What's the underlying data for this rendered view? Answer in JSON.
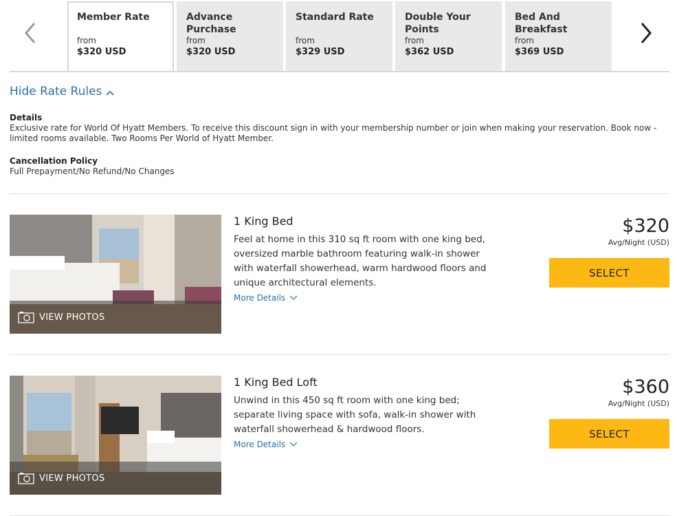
{
  "rate_tabs": {
    "prev_icon": "chevron-left-icon",
    "next_icon": "chevron-right-icon",
    "tabs": [
      {
        "name": "Member Rate",
        "from": "from",
        "price": "$320 USD",
        "active": true
      },
      {
        "name": "Advance Purchase",
        "from": "from",
        "price": "$320 USD",
        "active": false
      },
      {
        "name": "Standard Rate",
        "from": "from",
        "price": "$329 USD",
        "active": false
      },
      {
        "name": "Double Your Points",
        "from": "from",
        "price": "$362 USD",
        "active": false
      },
      {
        "name": "Bed And Breakfast",
        "from": "from",
        "price": "$369 USD",
        "active": false
      }
    ]
  },
  "rate_rules": {
    "toggle_label": "Hide Rate Rules",
    "toggle_icon": "chevron-up-icon",
    "details_heading": "Details",
    "details_text": "Exclusive rate for World Of Hyatt Members. To receive this discount sign in with your membership number or join when making your reservation. Book now - limited rooms available. Two Rooms Per World of Hyatt Member.",
    "cancel_heading": "Cancellation Policy",
    "cancel_text": "Full Prepayment/No Refund/No Changes"
  },
  "rooms": [
    {
      "title": "1 King Bed",
      "description": "Feel at home in this 310 sq ft room with one king bed, oversized marble bathroom featuring walk-in shower with waterfall showerhead, warm hardwood floors and unique architectural elements.",
      "more_details": "More Details",
      "view_photos": "VIEW PHOTOS",
      "price": "$320",
      "price_unit": "Avg/Night (USD)",
      "select_label": "SELECT"
    },
    {
      "title": "1 King Bed Loft",
      "description": "Unwind in this 450 sq ft room with one king bed; separate living space with sofa, walk-in shower with waterfall showerhead & hardwood floors.",
      "more_details": "More Details",
      "view_photos": "VIEW PHOTOS",
      "price": "$360",
      "price_unit": "Avg/Night (USD)",
      "select_label": "SELECT"
    }
  ],
  "colors": {
    "link_blue": "#2c6fa6",
    "select_yellow": "#fdb813",
    "tab_gray": "#e9e9e9"
  }
}
